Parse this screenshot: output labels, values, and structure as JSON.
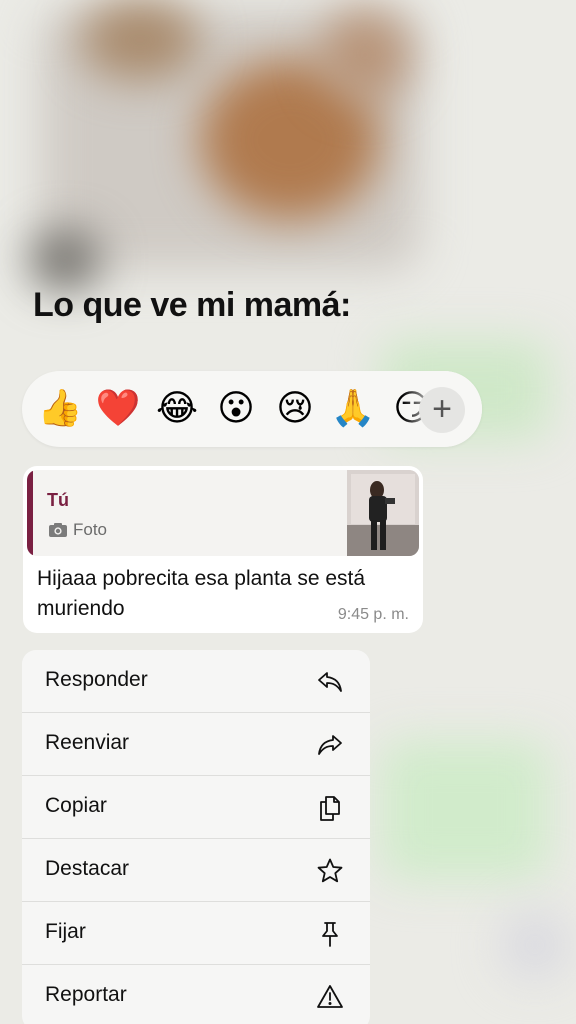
{
  "caption": "Lo que ve mi mamá:",
  "reactions": {
    "emojis": [
      {
        "name": "thumbs-up",
        "glyph": "👍"
      },
      {
        "name": "red-heart",
        "glyph": "❤️"
      },
      {
        "name": "tears-of-joy",
        "glyph": "😂",
        "selected": true
      },
      {
        "name": "surprised",
        "glyph": "😮"
      },
      {
        "name": "crying",
        "glyph": "😢"
      },
      {
        "name": "folded-hands",
        "glyph": "🙏"
      },
      {
        "name": "smirk",
        "glyph": "😏"
      }
    ],
    "add_label": "+"
  },
  "message": {
    "quote_author": "Tú",
    "quote_type": "Foto",
    "text": "Hijaaa pobrecita esa planta se está muriendo",
    "time": "9:45 p. m."
  },
  "menu": {
    "items": [
      {
        "label": "Responder",
        "icon": "reply-icon"
      },
      {
        "label": "Reenviar",
        "icon": "forward-icon"
      },
      {
        "label": "Copiar",
        "icon": "copy-icon"
      },
      {
        "label": "Destacar",
        "icon": "star-icon"
      },
      {
        "label": "Fijar",
        "icon": "pin-icon"
      },
      {
        "label": "Reportar",
        "icon": "warning-icon"
      }
    ]
  },
  "colors": {
    "quote_accent": "#7a2042",
    "bubble": "#ffffff",
    "menu_bg": "#f6f6f5"
  }
}
